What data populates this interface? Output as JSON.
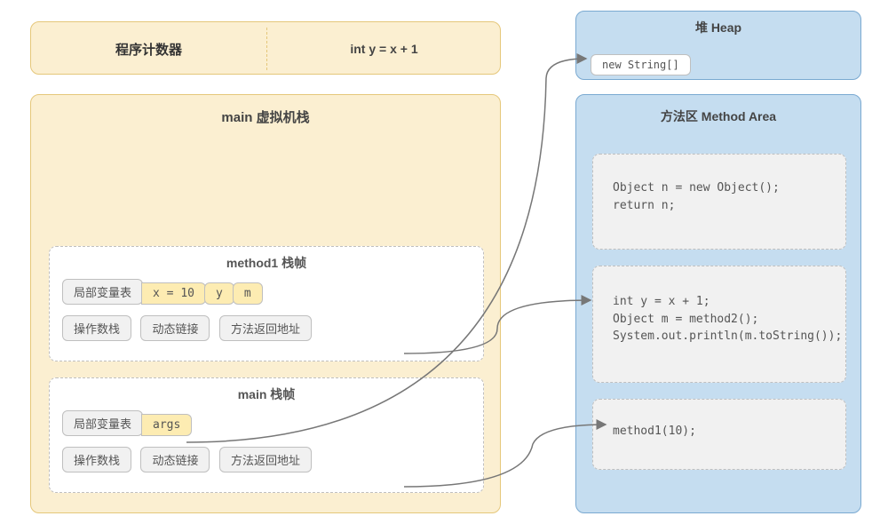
{
  "pc": {
    "title": "程序计数器",
    "current_instruction": "int y = x + 1"
  },
  "heap": {
    "title": "堆 Heap",
    "object_label": "new String[]"
  },
  "vm_stack": {
    "title": "main 虚拟机栈",
    "frames": [
      {
        "title": "method1 栈帧",
        "local_var_label": "局部变量表",
        "local_vars": [
          "x = 10",
          "y",
          "m"
        ],
        "operand_stack_label": "操作数栈",
        "dynamic_linking_label": "动态链接",
        "return_addr_label": "方法返回地址"
      },
      {
        "title": "main 栈帧",
        "local_var_label": "局部变量表",
        "local_vars": [
          "args"
        ],
        "operand_stack_label": "操作数栈",
        "dynamic_linking_label": "动态链接",
        "return_addr_label": "方法返回地址"
      }
    ]
  },
  "method_area": {
    "title": "方法区 Method Area",
    "code_blocks": [
      {
        "lines": [
          "Object n = new Object();",
          "return n;"
        ]
      },
      {
        "lines": [
          "int y = x + 1;",
          "Object m = method2();",
          "System.out.println(m.toString());"
        ]
      },
      {
        "lines": [
          "method1(10);"
        ]
      }
    ]
  },
  "colors": {
    "yellow_fill": "#FBEFD1",
    "yellow_border": "#E5C77A",
    "blue_fill": "#C5DDF0",
    "blue_border": "#7AA9D1",
    "gray_dash": "#BFBFBF",
    "highlight_yellow": "#FDECB2"
  }
}
